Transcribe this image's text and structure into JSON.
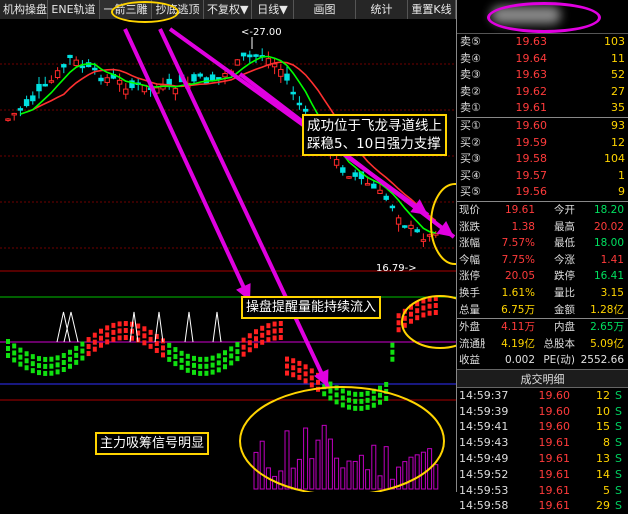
{
  "toolbar": {
    "tabs": [
      "机构操盘",
      "ENE轨道",
      "一箭三雕",
      "抄底逃顶",
      "不复权▼",
      "日线▼",
      "画图",
      "统计",
      "重置K线"
    ],
    "active_tab": "一箭三雕"
  },
  "chart": {
    "high_label": "<-27.00",
    "low_label": "16.79->",
    "annotations": {
      "main": "成功位于飞龙寻道线上\n踩稳5、10日强力支撑",
      "indicator": "操盘提醒量能持续流入",
      "volume": "主力吸筹信号明显"
    },
    "colors": {
      "rise": "#ff2a2a",
      "fall": "#00e0e0",
      "ma5": "#00ff00",
      "ma10": "#ff3030",
      "highlight": "#e000e0",
      "annotation_border": "#ffd400"
    }
  },
  "order_book": {
    "asks": [
      {
        "label": "卖⑤",
        "price": "19.63",
        "vol": "103"
      },
      {
        "label": "卖④",
        "price": "19.64",
        "vol": "11"
      },
      {
        "label": "卖③",
        "price": "19.63",
        "vol": "52"
      },
      {
        "label": "卖②",
        "price": "19.62",
        "vol": "27"
      },
      {
        "label": "卖①",
        "price": "19.61",
        "vol": "35"
      }
    ],
    "bids": [
      {
        "label": "买①",
        "price": "19.60",
        "vol": "93"
      },
      {
        "label": "买②",
        "price": "19.59",
        "vol": "12"
      },
      {
        "label": "买③",
        "price": "19.58",
        "vol": "104"
      },
      {
        "label": "买④",
        "price": "19.57",
        "vol": "1"
      },
      {
        "label": "买⑤",
        "price": "19.56",
        "vol": "9"
      }
    ]
  },
  "stats": [
    {
      "l1": "现价",
      "v1": "19.61",
      "c1": "red",
      "l2": "今开",
      "v2": "18.20",
      "c2": "green"
    },
    {
      "l1": "涨跌",
      "v1": "1.38",
      "c1": "red",
      "l2": "最高",
      "v2": "20.02",
      "c2": "red"
    },
    {
      "l1": "涨幅",
      "v1": "7.57%",
      "c1": "red",
      "l2": "最低",
      "v2": "18.00",
      "c2": "green"
    },
    {
      "l1": "今幅",
      "v1": "7.75%",
      "c1": "red",
      "l2": "今涨",
      "v2": "1.41",
      "c2": "red"
    },
    {
      "l1": "涨停",
      "v1": "20.05",
      "c1": "red",
      "l2": "跌停",
      "v2": "16.41",
      "c2": "green"
    },
    {
      "l1": "换手",
      "v1": "1.61%",
      "c1": "yellow",
      "l2": "量比",
      "v2": "3.15",
      "c2": "yellow"
    },
    {
      "l1": "总量",
      "v1": "6.75万",
      "c1": "yellow",
      "l2": "金额",
      "v2": "1.28亿",
      "c2": "yellow"
    },
    {
      "l1": "外盘",
      "v1": "4.11万",
      "c1": "red",
      "l2": "内盘",
      "v2": "2.65万",
      "c2": "green"
    },
    {
      "l1": "流通股",
      "v1": "4.19亿",
      "c1": "yellow",
      "l2": "总股本",
      "v2": "5.09亿",
      "c2": "yellow"
    },
    {
      "l1": "收益",
      "v1": "0.002",
      "c1": "white",
      "l2": "PE(动)",
      "v2": "2552.66",
      "c2": "white"
    }
  ],
  "deals": {
    "title": "成交明细",
    "rows": [
      {
        "time": "14:59:37",
        "price": "19.60",
        "vol": "12",
        "flag": "S"
      },
      {
        "time": "14:59:39",
        "price": "19.60",
        "vol": "10",
        "flag": "S"
      },
      {
        "time": "14:59:41",
        "price": "19.60",
        "vol": "15",
        "flag": "S"
      },
      {
        "time": "14:59:43",
        "price": "19.61",
        "vol": "8",
        "flag": "S"
      },
      {
        "time": "14:59:49",
        "price": "19.61",
        "vol": "13",
        "flag": "S"
      },
      {
        "time": "14:59:52",
        "price": "19.61",
        "vol": "14",
        "flag": "S"
      },
      {
        "time": "14:59:53",
        "price": "19.61",
        "vol": "5",
        "flag": "S"
      },
      {
        "time": "14:59:58",
        "price": "19.61",
        "vol": "29",
        "flag": "S"
      }
    ]
  }
}
